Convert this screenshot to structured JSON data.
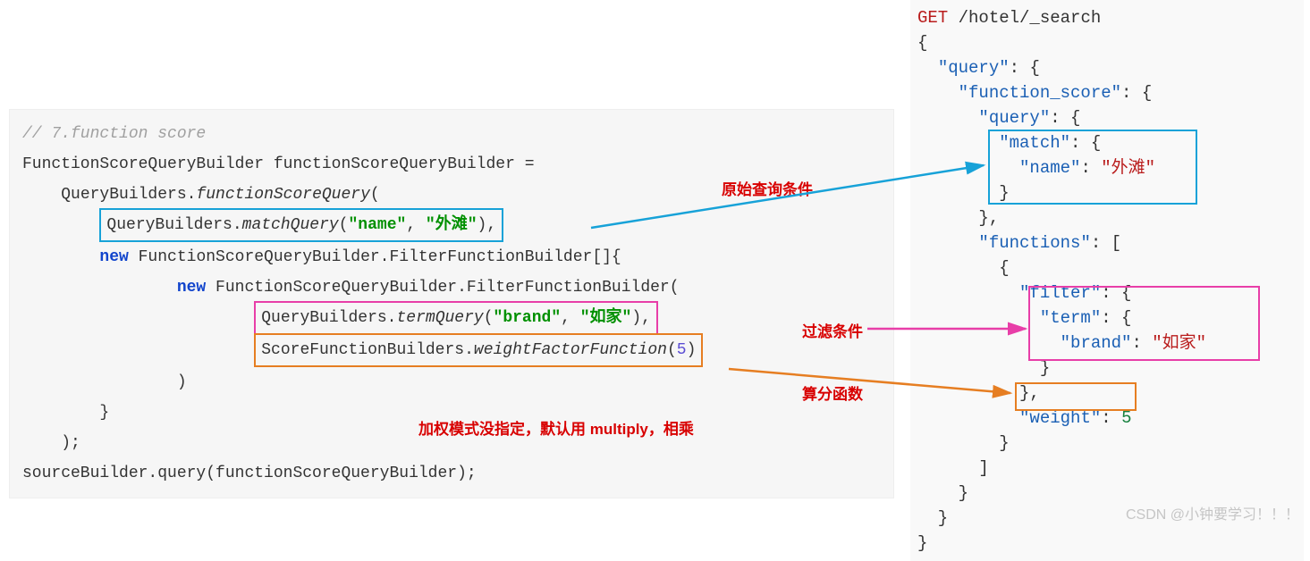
{
  "left": {
    "comment": "// 7.function score",
    "line1": "FunctionScoreQueryBuilder functionScoreQueryBuilder =",
    "line2_a": "QueryBuilders.",
    "line2_b": "functionScoreQuery",
    "line2_c": "(",
    "match_a": "QueryBuilders.",
    "match_b": "matchQuery",
    "match_c": "(",
    "match_k": "\"name\"",
    "match_sep": ", ",
    "match_v": "\"外滩\"",
    "match_end": "),",
    "ffb_new": "new",
    "ffb_1": " FunctionScoreQueryBuilder.FilterFunctionBuilder[]{",
    "ffb_inner_new": "new",
    "ffb_inner_1": " FunctionScoreQueryBuilder.FilterFunctionBuilder(",
    "term_a": "QueryBuilders.",
    "term_b": "termQuery",
    "term_c": "(",
    "term_k": "\"brand\"",
    "term_sep": ", ",
    "term_v": "\"如家\"",
    "term_end": "),",
    "weight_a": "ScoreFunctionBuilders.",
    "weight_b": "weightFactorFunction",
    "weight_c": "(",
    "weight_n": "5",
    "weight_end": ")",
    "close_paren": ")",
    "close_brace": "}",
    "close_call": ");",
    "last": "sourceBuilder.query(functionScoreQueryBuilder);"
  },
  "right": {
    "l1a": "GET",
    "l1b": " /hotel/_search",
    "l2": "{",
    "l3a": "  ",
    "l3k": "\"query\"",
    "l3b": ": {",
    "l4a": "    ",
    "l4k": "\"function_score\"",
    "l4b": ": {",
    "l5a": "      ",
    "l5k": "\"query\"",
    "l5b": ": {",
    "l6a": "        ",
    "l6k": "\"match\"",
    "l6b": ": {",
    "l7a": "          ",
    "l7k": "\"name\"",
    "l7b": ": ",
    "l7v": "\"外滩\"",
    "l8": "        }",
    "l9": "      },",
    "l10a": "      ",
    "l10k": "\"functions\"",
    "l10b": ": [",
    "l11": "        {",
    "l12a": "          ",
    "l12k": "\"filter\"",
    "l12b": ": {",
    "l13a": "            ",
    "l13k": "\"term\"",
    "l13b": ": {",
    "l14a": "              ",
    "l14k": "\"brand\"",
    "l14b": ": ",
    "l14v": "\"如家\"",
    "l15": "            }",
    "l16": "          },",
    "l17a": "          ",
    "l17k": "\"weight\"",
    "l17b": ": ",
    "l17v": "5",
    "l18": "        }",
    "l19": "      ]",
    "l20": "    }",
    "l21": "  }",
    "l22": "}"
  },
  "annotations": {
    "a1": "原始查询条件",
    "a2": "过滤条件",
    "a3": "算分函数",
    "a4": "加权模式没指定，默认用 multiply，相乘"
  },
  "watermark": "CSDN @小钟要学习！！！"
}
